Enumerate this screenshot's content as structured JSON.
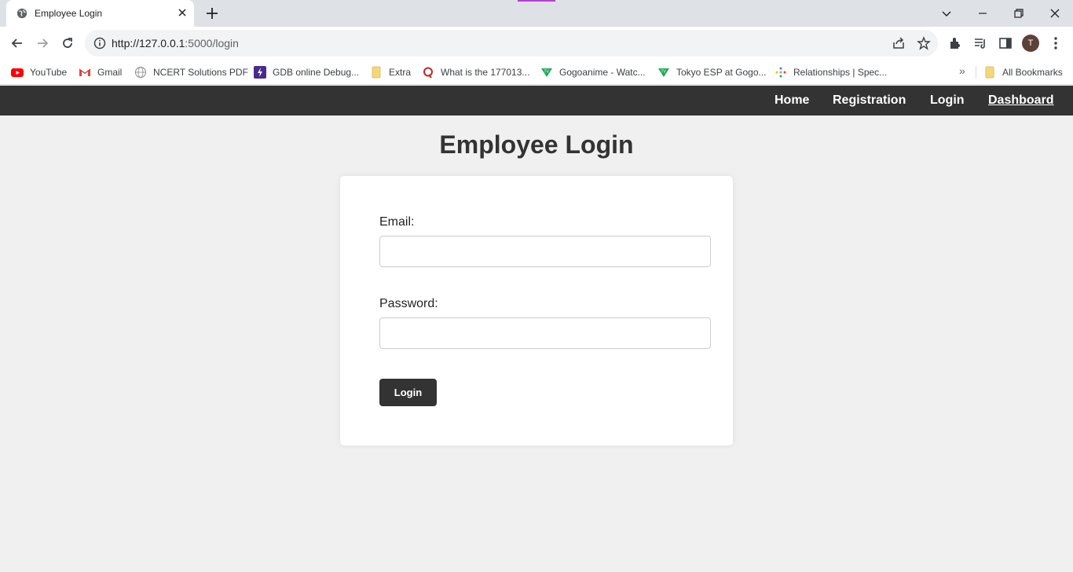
{
  "browser": {
    "tab_title": "Employee Login",
    "url_host": "http://127.0.0.1",
    "url_rest": ":5000/login",
    "profile_initial": "T",
    "bookmarks": [
      {
        "label": "YouTube",
        "icon": "youtube-icon"
      },
      {
        "label": "Gmail",
        "icon": "gmail-icon"
      },
      {
        "label": "NCERT Solutions PDF",
        "icon": "globe-icon"
      },
      {
        "label": "GDB online Debug...",
        "icon": "gdb-icon"
      },
      {
        "label": "Extra",
        "icon": "folder-icon"
      },
      {
        "label": "What is the 177013...",
        "icon": "quora-icon"
      },
      {
        "label": "Gogoanime - Watc...",
        "icon": "gogoanime-icon"
      },
      {
        "label": "Tokyo ESP at Gogo...",
        "icon": "gogoanime-icon"
      },
      {
        "label": "Relationships | Spec...",
        "icon": "spec-icon"
      }
    ],
    "all_bookmarks": "All Bookmarks",
    "more_chevron": "»"
  },
  "nav": {
    "links": [
      "Home",
      "Registration",
      "Login",
      "Dashboard"
    ]
  },
  "page": {
    "title": "Employee Login",
    "email_label": "Email:",
    "email_value": "",
    "password_label": "Password:",
    "password_value": "",
    "login_button": "Login"
  },
  "colors": {
    "navbar_bg": "#333333",
    "page_bg": "#f0f0f0",
    "button_bg": "#333333"
  }
}
